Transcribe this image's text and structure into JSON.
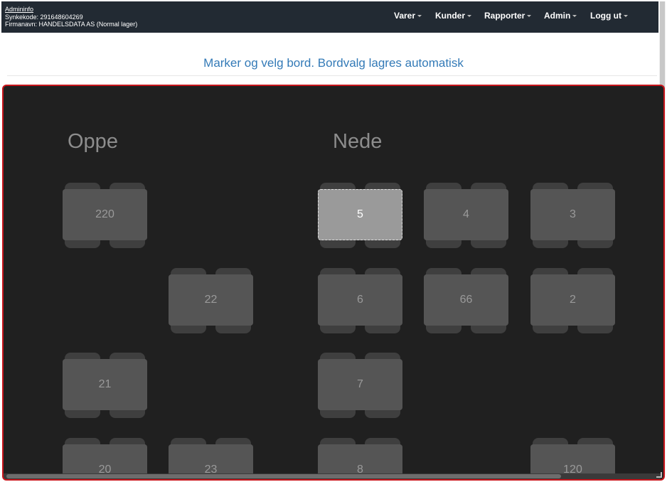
{
  "header": {
    "admininfo_link": "Admininfo",
    "synkekode": "Synkekode: 291648604269",
    "firmanavn": "Firmanavn: HANDELSDATA AS (Normal lager)"
  },
  "nav": {
    "items": [
      {
        "label": "Varer"
      },
      {
        "label": "Kunder"
      },
      {
        "label": "Rapporter"
      },
      {
        "label": "Admin"
      },
      {
        "label": "Logg ut"
      }
    ]
  },
  "page": {
    "heading": "Marker og velg bord. Bordvalg lagres automatisk"
  },
  "floor": {
    "zones": [
      "Oppe",
      "Nede"
    ],
    "tables": [
      {
        "label": "220",
        "selected": false
      },
      {
        "label": "22",
        "selected": false
      },
      {
        "label": "21",
        "selected": false
      },
      {
        "label": "20",
        "selected": false
      },
      {
        "label": "23",
        "selected": false
      },
      {
        "label": "5",
        "selected": true
      },
      {
        "label": "4",
        "selected": false
      },
      {
        "label": "3",
        "selected": false
      },
      {
        "label": "6",
        "selected": false
      },
      {
        "label": "66",
        "selected": false
      },
      {
        "label": "2",
        "selected": false
      },
      {
        "label": "7",
        "selected": false
      },
      {
        "label": "8",
        "selected": false
      },
      {
        "label": "120",
        "selected": false
      }
    ]
  },
  "colors": {
    "navbar_bg": "#222a33",
    "heading": "#337ab7",
    "floor_bg": "#202020",
    "floor_border": "#c8151b",
    "table": "#555555",
    "table_selected": "#9a9a9a"
  }
}
